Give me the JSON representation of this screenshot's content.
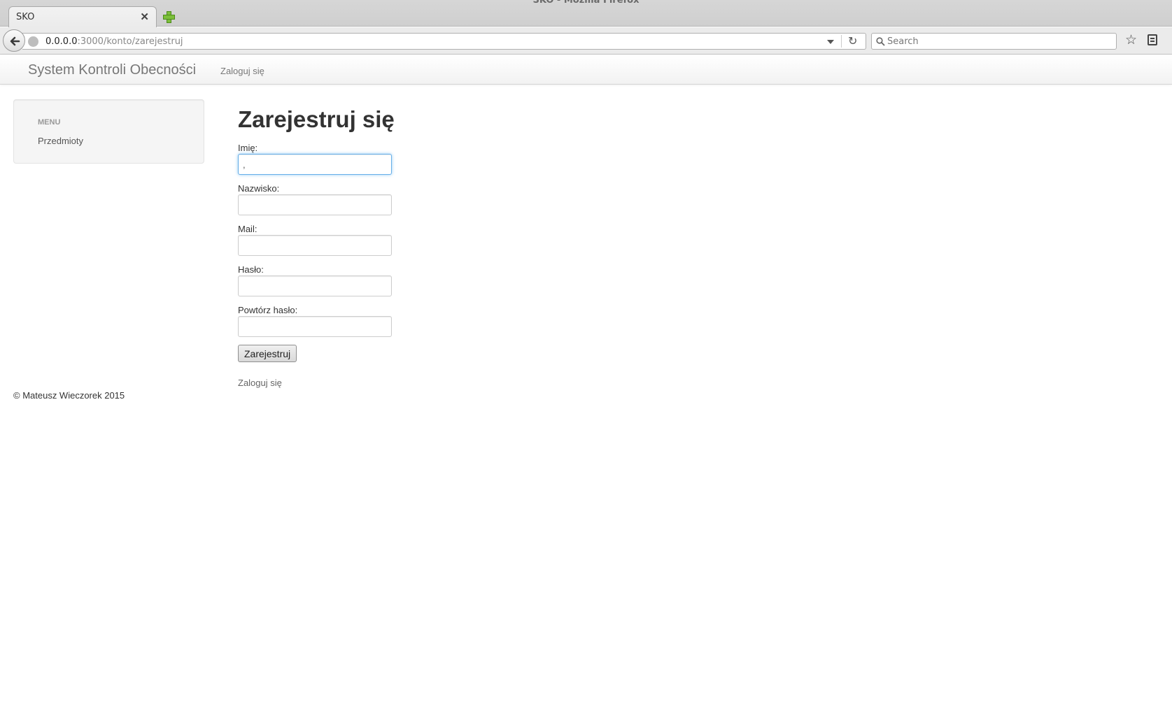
{
  "browser": {
    "window_title": "SKO - Mozilla Firefox",
    "tab_title": "SKO",
    "url_host": "0.0.0.0",
    "url_rest": ":3000/konto/zarejestruj",
    "search_placeholder": "Search"
  },
  "navbar": {
    "brand": "System Kontroli Obecności",
    "login_link": "Zaloguj się"
  },
  "sidebar": {
    "header": "MENU",
    "items": [
      {
        "label": "Przedmioty"
      }
    ]
  },
  "form": {
    "title": "Zarejestruj się",
    "fields": [
      {
        "label": "Imię:",
        "value": ","
      },
      {
        "label": "Nazwisko:",
        "value": ""
      },
      {
        "label": "Mail:",
        "value": ""
      },
      {
        "label": "Hasło:",
        "value": ""
      },
      {
        "label": "Powtórz hasło:",
        "value": ""
      }
    ],
    "submit_label": "Zarejestruj",
    "login_link": "Zaloguj się"
  },
  "footer": {
    "text": "© Mateusz Wieczorek 2015"
  }
}
